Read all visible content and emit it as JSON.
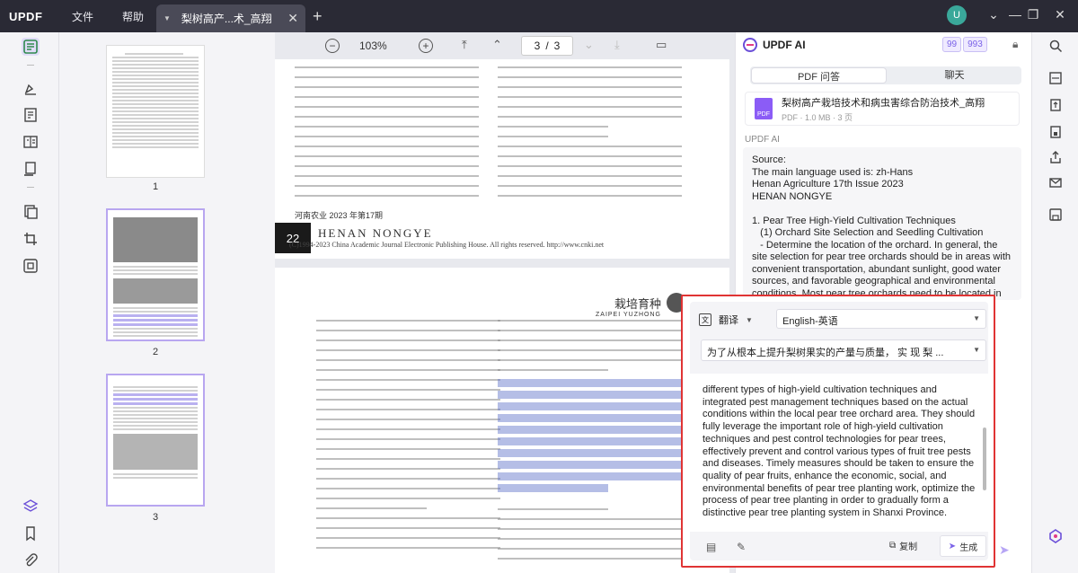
{
  "app": {
    "logo": "UPDF",
    "menus": [
      "文件",
      "帮助"
    ],
    "tab_title": "梨树高产...术_高翔",
    "avatar_letter": "U",
    "accent": "#7a62e8"
  },
  "viewer": {
    "zoom": "103%",
    "current_page": "3",
    "page_sep": "/",
    "total_pages": "3",
    "page2_footer": "河南农业 2023 年第17期",
    "banner_num": "22",
    "banner_title": "HENAN   NONGYE",
    "banner_copy": "(C)1994-2023 China Academic Journal Electronic Publishing House. All rights reserved.    http://www.cnki.net",
    "section_title": "栽培育种",
    "section_sub": "ZAIPEI   YUZHONG"
  },
  "thumbnails": [
    {
      "num": "1"
    },
    {
      "num": "2"
    },
    {
      "num": "3"
    }
  ],
  "ai": {
    "title": "UPDF AI",
    "badge1": "99",
    "badge2": "993",
    "tab_pdf": "PDF 问答",
    "tab_chat": "聊天",
    "file_name": "梨树高产栽培技术和病虫害综合防治技术_高翔",
    "file_meta": "PDF · 1.0 MB · 3 页",
    "label": "UPDF AI",
    "answer": "Source:\nThe main language used is: zh-Hans\nHenan Agriculture 17th Issue 2023\nHENAN NONGYE\n\n1. Pear Tree High-Yield Cultivation Techniques\n   (1) Orchard Site Selection and Seedling Cultivation\n   - Determine the location of the orchard. In general, the site selection for pear tree orchards should be in areas with convenient transportation, abundant sunlight, good water sources, and favorable geographical and environmental conditions. Most pear tree orchards need to be located in"
  },
  "translate": {
    "mode": "翻译",
    "target_lang": "English-英语",
    "source_text": "为了从根本上提升梨树果实的产量与质量， 实 现 梨 ...",
    "result": "different types of high-yield cultivation techniques and integrated pest management techniques based on the actual conditions within the local pear tree orchard area. They should fully leverage the important role of high-yield cultivation techniques and pest control technologies for pear trees, effectively prevent and control various types of fruit tree pests and diseases. Timely measures should be taken to ensure the quality of pear fruits, enhance the economic, social, and environmental benefits of pear tree planting work, optimize the process of pear tree planting in order to gradually form a distinctive pear tree planting system in Shanxi Province.",
    "copy_label": "复制",
    "generate_label": "生成"
  }
}
